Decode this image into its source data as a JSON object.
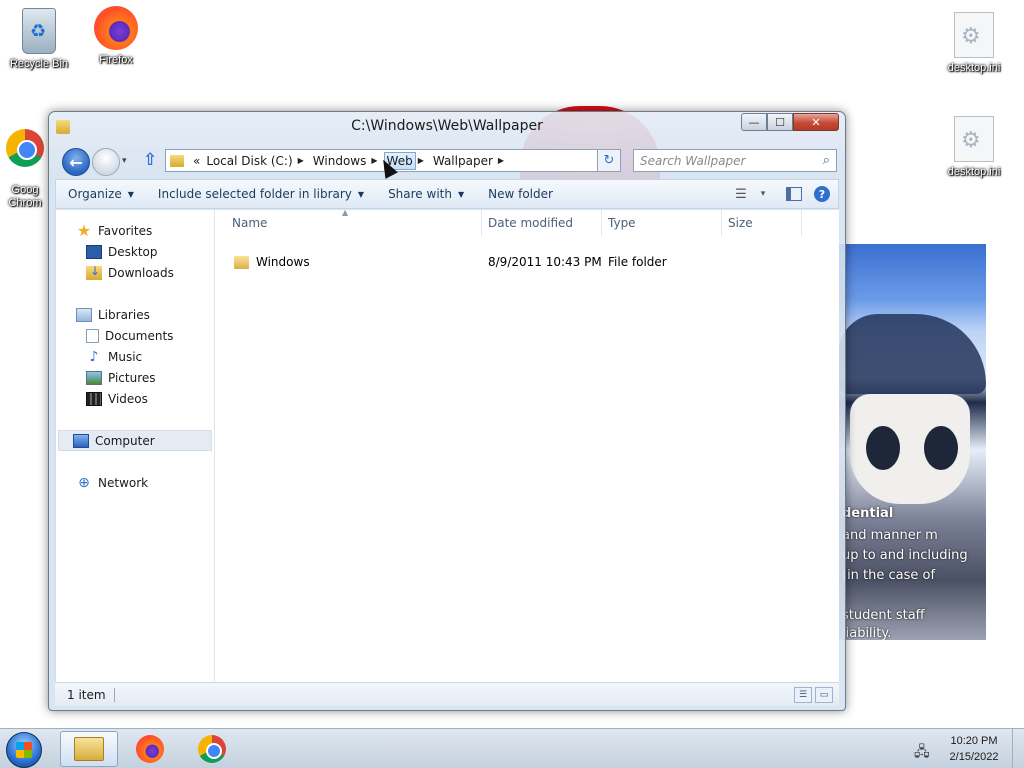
{
  "desktop": {
    "icons": [
      {
        "label": "Recycle Bin",
        "icon": "recycle-bin-icon"
      },
      {
        "label": "Firefox",
        "icon": "firefox-icon"
      },
      {
        "label": "Goog\nChrom",
        "icon": "chrome-icon"
      },
      {
        "label": "desktop.ini",
        "icon": "ini-file-icon"
      },
      {
        "label": "desktop.ini",
        "icon": "ini-file-icon"
      }
    ],
    "wallpaper_overlay_lines": [
      "dential",
      "and manner m",
      "up to and including",
      "(in the case of",
      "student staff",
      "liability."
    ]
  },
  "window": {
    "title": "C:\\Windows\\Web\\Wallpaper",
    "caption_buttons": {
      "minimize": "—",
      "maximize": "☐",
      "close": "✕"
    },
    "nav": {
      "back": "←",
      "forward": "",
      "recent": "▾",
      "up": "⇧"
    },
    "address": {
      "overflow": "«",
      "crumbs": [
        "Local Disk (C:)",
        "Windows",
        "Web",
        "Wallpaper"
      ],
      "separator": "▶",
      "dropdown": "▾",
      "refresh": "↻"
    },
    "search": {
      "placeholder": "Search Wallpaper",
      "value": ""
    },
    "commands": [
      {
        "label": "Organize",
        "dropdown": true
      },
      {
        "label": "Include selected folder in library",
        "dropdown": true
      },
      {
        "label": "Share with",
        "dropdown": true
      },
      {
        "label": "New folder",
        "dropdown": false
      }
    ],
    "command_right": {
      "views": "☰",
      "views_dd": "▾",
      "help": "?"
    },
    "navpane": {
      "favorites": {
        "label": "Favorites",
        "items": [
          "Desktop",
          "Downloads"
        ]
      },
      "libraries": {
        "label": "Libraries",
        "items": [
          "Documents",
          "Music",
          "Pictures",
          "Videos"
        ]
      },
      "computer": "Computer",
      "network": "Network"
    },
    "columns": [
      "Name",
      "Date modified",
      "Type",
      "Size"
    ],
    "sort_indicator": "▲",
    "rows": [
      {
        "name": "Windows",
        "date_modified": "8/9/2011 10:43 PM",
        "type": "File folder",
        "size": ""
      }
    ],
    "status": {
      "item_count": "1 item"
    }
  },
  "taskbar": {
    "pinned": [
      "Windows Explorer",
      "Firefox",
      "Google Chrome"
    ],
    "clock": {
      "time": "10:20 PM",
      "date": "2/15/2022"
    }
  },
  "colors": {
    "accent": "#2f6fd0",
    "close_button": "#c84a36",
    "heart": "#d4141e"
  }
}
